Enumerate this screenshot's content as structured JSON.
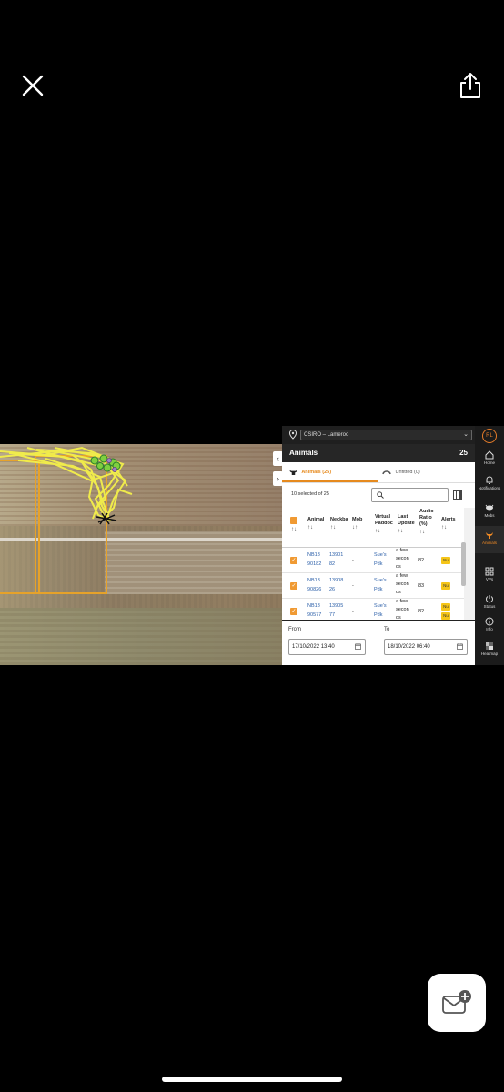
{
  "viewer": {
    "close_icon": "close-x-icon",
    "share_icon": "share-icon",
    "mail_icon": "mail-add-icon"
  },
  "app": {
    "account_select": "CSIRO – Lameroo",
    "user_initials": "RL",
    "accent_color": "#f08a24"
  },
  "nav": {
    "items": [
      {
        "label": "Home",
        "icon": "home-icon"
      },
      {
        "label": "Notifications",
        "icon": "bell-icon"
      },
      {
        "label": "Mobs",
        "icon": "mobs-icon"
      },
      {
        "label": "Animals",
        "icon": "animal-icon",
        "active": true
      },
      {
        "label": "VPs",
        "icon": "grid-icon"
      },
      {
        "label": "Status",
        "icon": "power-icon"
      },
      {
        "label": "Info",
        "icon": "info-icon"
      },
      {
        "label": "Heatmap",
        "icon": "heatmap-icon"
      }
    ]
  },
  "panel": {
    "title": "Animals",
    "count": "25",
    "tabs": [
      {
        "label": "Animals (25)",
        "active": true
      },
      {
        "label": "Unfitted (0)",
        "active": false
      }
    ],
    "selection_text": "10 selected of 25",
    "columns": [
      "Animal",
      "Neckba",
      "Mob",
      "Virtual Paddoc",
      "Last Update",
      "Audio Ratio (%)",
      "Alerts"
    ],
    "sort_icons": [
      "↑↓",
      "↑↓",
      "↑↓",
      "↓↑",
      "↑↓",
      "↑↓",
      "↑↓",
      "↑↓"
    ],
    "rows": [
      {
        "animal": [
          "NB13",
          "90182"
        ],
        "neckband": [
          "13901",
          "82"
        ],
        "mob": "-",
        "vp": [
          "Sue's",
          "Pdk"
        ],
        "last_update": [
          "a few",
          "secon",
          "ds"
        ],
        "audio_ratio": "82",
        "alerts": [
          "Nu"
        ]
      },
      {
        "animal": [
          "NB13",
          "90826"
        ],
        "neckband": [
          "13908",
          "26"
        ],
        "mob": "-",
        "vp": [
          "Sue's",
          "Pdk"
        ],
        "last_update": [
          "a few",
          "secon",
          "ds"
        ],
        "audio_ratio": "83",
        "alerts": [
          "Nu"
        ]
      },
      {
        "animal": [
          "NB13",
          "90577"
        ],
        "neckband": [
          "13905",
          "77"
        ],
        "mob": "-",
        "vp": [
          "Sue's",
          "Pdk"
        ],
        "last_update": [
          "a few",
          "secon",
          "ds"
        ],
        "audio_ratio": "82",
        "alerts": [
          "Nu",
          "Nu"
        ]
      }
    ],
    "from_label": "From",
    "to_label": "To",
    "from_value": "17/10/2022 13:40",
    "to_value": "18/10/2022 06:40"
  }
}
